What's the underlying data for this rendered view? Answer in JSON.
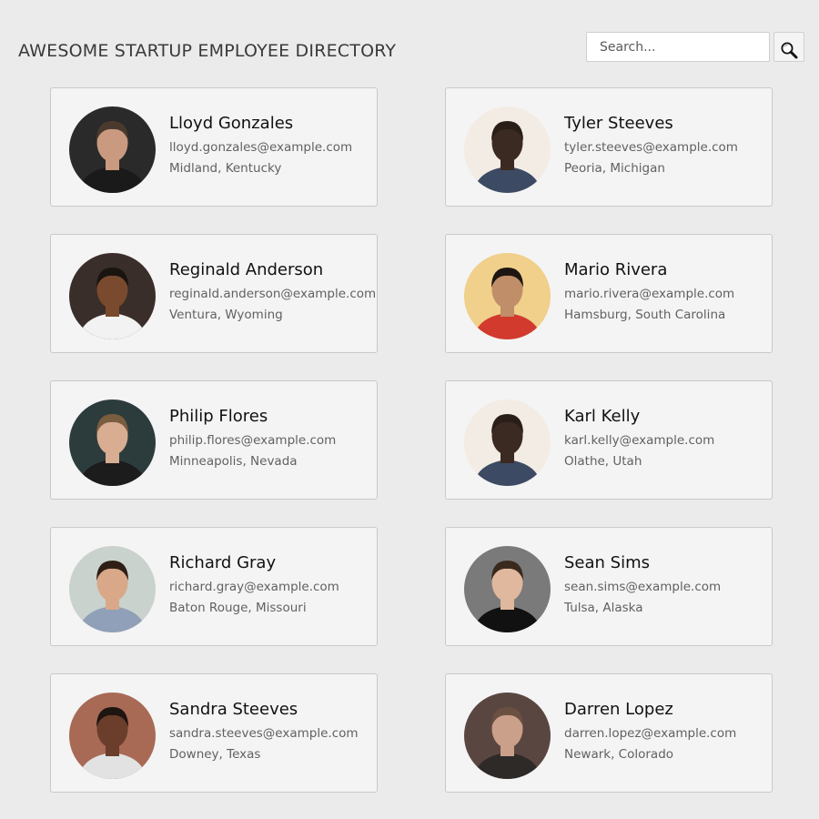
{
  "header": {
    "title": "AWESOME STARTUP EMPLOYEE DIRECTORY",
    "search_placeholder": "Search...",
    "search_icon": "magnifying-glass-icon"
  },
  "employees": [
    {
      "name": "Lloyd Gonzales",
      "email": "lloyd.gonzales@example.com",
      "location": "Midland, Kentucky",
      "photo": {
        "bg": "#2a2a2a",
        "skin": "#c99a7f",
        "hair": "#4a3a2e",
        "shirt": "#1a1a1a"
      }
    },
    {
      "name": "Tyler Steeves",
      "email": "tyler.steeves@example.com",
      "location": "Peoria, Michigan",
      "photo": {
        "bg": "#f3ece4",
        "skin": "#3b2a22",
        "hair": "#2a1e18",
        "shirt": "#3c4a63"
      }
    },
    {
      "name": "Reginald Anderson",
      "email": "reginald.anderson@example.com",
      "location": "Ventura, Wyoming",
      "photo": {
        "bg": "#3a2e2a",
        "skin": "#7a4a2e",
        "hair": "#1a1410",
        "shirt": "#f2f2f2"
      }
    },
    {
      "name": "Mario Rivera",
      "email": "mario.rivera@example.com",
      "location": "Hamsburg, South Carolina",
      "photo": {
        "bg": "#f0d08a",
        "skin": "#c08e68",
        "hair": "#1e1612",
        "shirt": "#d23a2e"
      }
    },
    {
      "name": "Philip Flores",
      "email": "philip.flores@example.com",
      "location": "Minneapolis, Nevada",
      "photo": {
        "bg": "#2c3c3c",
        "skin": "#d9ad92",
        "hair": "#7a5c3e",
        "shirt": "#1c1c1c"
      }
    },
    {
      "name": "Karl Kelly",
      "email": "karl.kelly@example.com",
      "location": "Olathe, Utah",
      "photo": {
        "bg": "#f3ece4",
        "skin": "#3b2a22",
        "hair": "#2a1e18",
        "shirt": "#3c4a63"
      }
    },
    {
      "name": "Richard Gray",
      "email": "richard.gray@example.com",
      "location": "Baton Rouge, Missouri",
      "photo": {
        "bg": "#c9d2cc",
        "skin": "#d9a889",
        "hair": "#2e1e16",
        "shirt": "#8fa0b8"
      }
    },
    {
      "name": "Sean Sims",
      "email": "sean.sims@example.com",
      "location": "Tulsa, Alaska",
      "photo": {
        "bg": "#7a7a7a",
        "skin": "#e0b89e",
        "hair": "#3a2a1e",
        "shirt": "#111111"
      }
    },
    {
      "name": "Sandra Steeves",
      "email": "sandra.steeves@example.com",
      "location": "Downey, Texas",
      "photo": {
        "bg": "#a86a55",
        "skin": "#6a3e2a",
        "hair": "#1e1410",
        "shirt": "#e2e2e2"
      }
    },
    {
      "name": "Darren Lopez",
      "email": "darren.lopez@example.com",
      "location": "Newark, Colorado",
      "photo": {
        "bg": "#5a4640",
        "skin": "#caa08a",
        "hair": "#6a5040",
        "shirt": "#2e2a28"
      }
    }
  ]
}
